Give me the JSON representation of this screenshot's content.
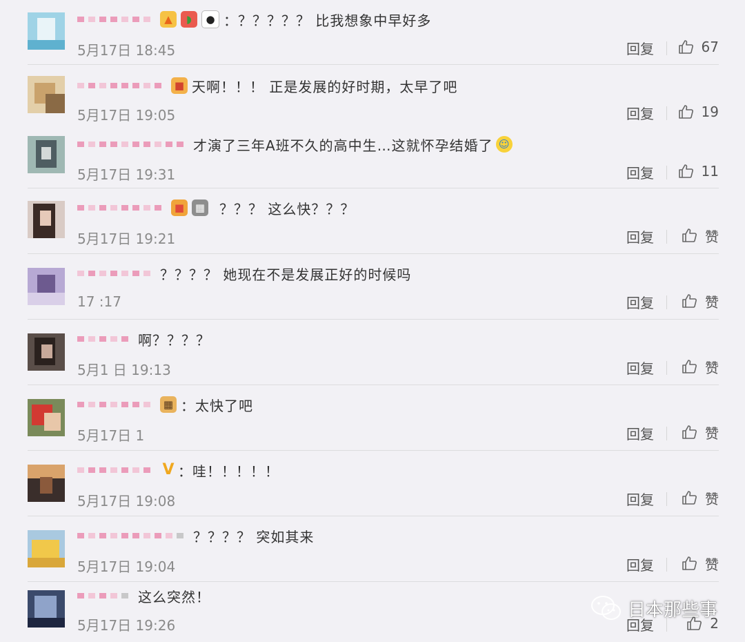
{
  "actions": {
    "reply_label": "回复"
  },
  "comments": [
    {
      "text": "：？？？？？ 比我想象中早好多",
      "time": "5月17日 18:45",
      "likes": "67"
    },
    {
      "text": "天啊！！！ 正是发展的好时期，太早了吧",
      "time": "5月17日 19:05",
      "likes": "19"
    },
    {
      "text": "才演了三年A班不久的高中生…这就怀孕结婚了",
      "time": "5月17日 19:31",
      "likes": "11"
    },
    {
      "text": "？？？ 这么快？？？",
      "time": "5月17日 19:21",
      "likes": "赞"
    },
    {
      "text": "？？？？ 她现在不是发展正好的时候吗",
      "time": "17  :17",
      "likes": "赞"
    },
    {
      "text": "啊？？？？",
      "time": "5月1  日 19:13",
      "likes": "赞"
    },
    {
      "text": "：太快了吧",
      "time": "5月17日 1",
      "likes": "赞"
    },
    {
      "text": "：哇！！！！！",
      "time": "5月17日 19:08",
      "likes": "赞"
    },
    {
      "text": "？？？？ 突如其来",
      "time": "5月17日 19:04",
      "likes": "赞"
    },
    {
      "text": "这么突然！",
      "time": "5月17日 19:26",
      "likes": "2"
    }
  ],
  "watermark": {
    "text": "日本那些事"
  },
  "colors": {
    "background": "#f2f1f5",
    "text": "#333333",
    "meta": "#8a8a8a",
    "nickname_blur": "#e87fa6"
  }
}
